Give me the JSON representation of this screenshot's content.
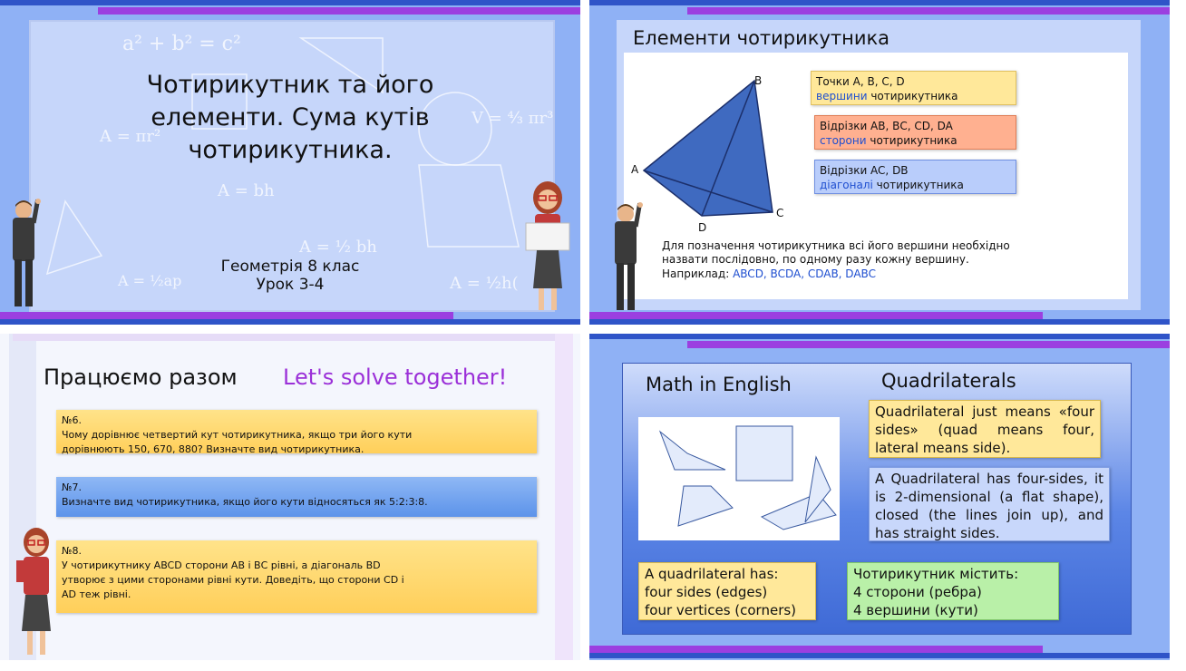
{
  "slide1": {
    "title": "Чотирикутник та його\nелементи. Сума кутів\nчотирикутника.",
    "subtitle_line1": "Геометрія 8 клас",
    "subtitle_line2": "Урок 3-4",
    "formulas": [
      "a² + b² = c²",
      "A = bh",
      "A = ½ bh",
      "A = ½ap",
      "V = ⁴⁄₃ πr³",
      "A = ½h(",
      "A = πr²"
    ]
  },
  "slide2": {
    "title": "Елементи чотирикутника",
    "vertices": [
      "A",
      "B",
      "C",
      "D"
    ],
    "box1_line1": "Точки А, В, С, D",
    "box1_word": "вершини",
    "box1_rest": " чотирикутника",
    "box2_line1": "Відрізки АВ, ВС, CD, DA",
    "box2_word": "сторони",
    "box2_rest": " чотирикутника",
    "box3_line1": "Відрізки AC, DB",
    "box3_word": "діагоналі",
    "box3_rest": " чотирикутника",
    "note": "Для позначення чотирикутника всі його вершини необхідно\nназвати послідовно, по одному разу кожну вершину.",
    "example_label": "Наприклад: ",
    "example_value": "ABCD, BCDA, CDAB, DABC"
  },
  "slide3": {
    "title_ua": "Працюємо разом",
    "title_en": "Let's solve together!",
    "task6_num": "№6.",
    "task6_text": "Чому дорівнює четвертий кут чотирикутника, якщо три його кути\nдорівнюють 150, 670, 880? Визначте вид чотирикутника.",
    "task7_num": "№7.",
    "task7_text": "Визначте вид чотирикутника, якщо його кути відносяться як 5:2:3:8.",
    "task8_num": "№8.",
    "task8_text": "У чотирикутнику ABCD сторони АВ і ВС рівні, а діагональ BD\nутворює з цими сторонами рівні кути. Доведіть, що сторони CD і\nAD теж рівні."
  },
  "slide4": {
    "title_left": "Math in English",
    "title_right": "Quadrilaterals",
    "box1": "Quadrilateral just means «four sides» (quad means four, lateral means side).",
    "box2": "A Quadrilateral has four-sides, it is 2-dimensional (a flat shape), closed (the lines join up), and has straight sides.",
    "box3_line1": "A quadrilateral has:",
    "box3_line2": "four sides (edges)",
    "box3_line3": "four vertices (corners)",
    "box4_line1": "Чотирикутник містить:",
    "box4_line2": "4 сторони (ребра)",
    "box4_line3": "4 вершини (кути)"
  },
  "colors": {
    "slide_blue": "#8fb1f5",
    "panel_blue": "#3f6fd8",
    "purple_bar": "#9b3fe0",
    "yellow_box": "#ffe89a",
    "orange_box": "#ffb090",
    "blue_box": "#b9cdfb",
    "green_box": "#b9f0a8",
    "highlight_blue": "#1f4fd0"
  }
}
